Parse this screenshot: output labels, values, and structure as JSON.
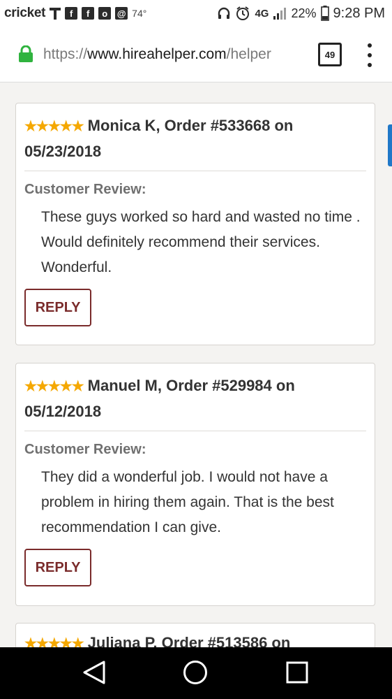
{
  "status_bar": {
    "carrier": "cricket",
    "temperature": "74°",
    "signal_label": "4G",
    "battery": "22%",
    "time": "9:28 PM"
  },
  "browser": {
    "url_scheme": "https://",
    "url_host": "www.hireahelper.com",
    "url_rest": "/helper",
    "tab_count": "49",
    "colors": {
      "lock": "#2fb33e"
    }
  },
  "reviews": [
    {
      "stars": "★★★★★",
      "header": "Monica K, Order #533668 on 05/23/2018",
      "label": "Customer Review:",
      "text": "These guys worked so hard and wasted no time . Would definitely recommend their services. Wonderful.",
      "reply_label": "REPLY"
    },
    {
      "stars": "★★★★★",
      "header": "Manuel M, Order #529984 on 05/12/2018",
      "label": "Customer Review:",
      "text": "They did a wonderful job. I would not have a problem in hiring them again. That is the best recommendation I can give.",
      "reply_label": "REPLY"
    },
    {
      "stars": "★★★★★",
      "header": "Juliana P, Order #513586 on",
      "label": "",
      "text": "",
      "reply_label": ""
    }
  ],
  "theme": {
    "star_color": "#f5a800",
    "reply_color": "#7a2b2b",
    "side_tab_color": "#1f78c8"
  }
}
